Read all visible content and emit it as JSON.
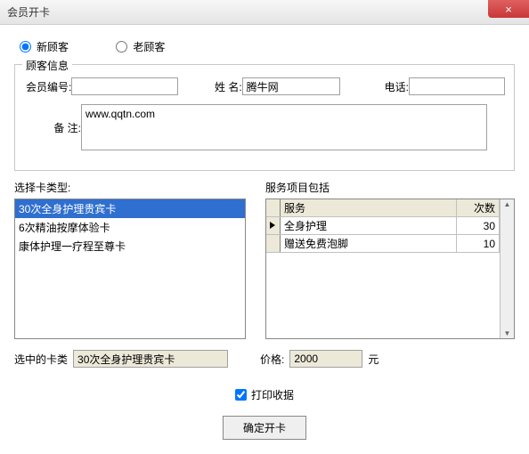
{
  "window": {
    "title": "会员开卡",
    "close": "×"
  },
  "radios": {
    "new": "新顾客",
    "old": "老顾客"
  },
  "customer": {
    "legend": "顾客信息",
    "member_id_label": "会员编号:",
    "member_id": "",
    "name_label": "姓 名:",
    "name": "腾牛网",
    "phone_label": "电话:",
    "phone": "",
    "remark_label": "备 注:",
    "remark": "www.qqtn.com"
  },
  "card_types": {
    "header": "选择卡类型:",
    "items": [
      "30次全身护理贵宾卡",
      "6次精油按摩体验卡",
      "康体护理一疗程至尊卡"
    ]
  },
  "services": {
    "header": "服务项目包括",
    "col_service": "服务",
    "col_count": "次数",
    "rows": [
      {
        "name": "全身护理",
        "count": "30"
      },
      {
        "name": "赠送免费泡脚",
        "count": "10"
      }
    ]
  },
  "selected": {
    "label": "选中的卡类",
    "value": "30次全身护理贵宾卡"
  },
  "price": {
    "label": "价格:",
    "value": "2000",
    "unit": "元"
  },
  "print": {
    "label": "打印收据"
  },
  "confirm": {
    "label": "确定开卡"
  }
}
